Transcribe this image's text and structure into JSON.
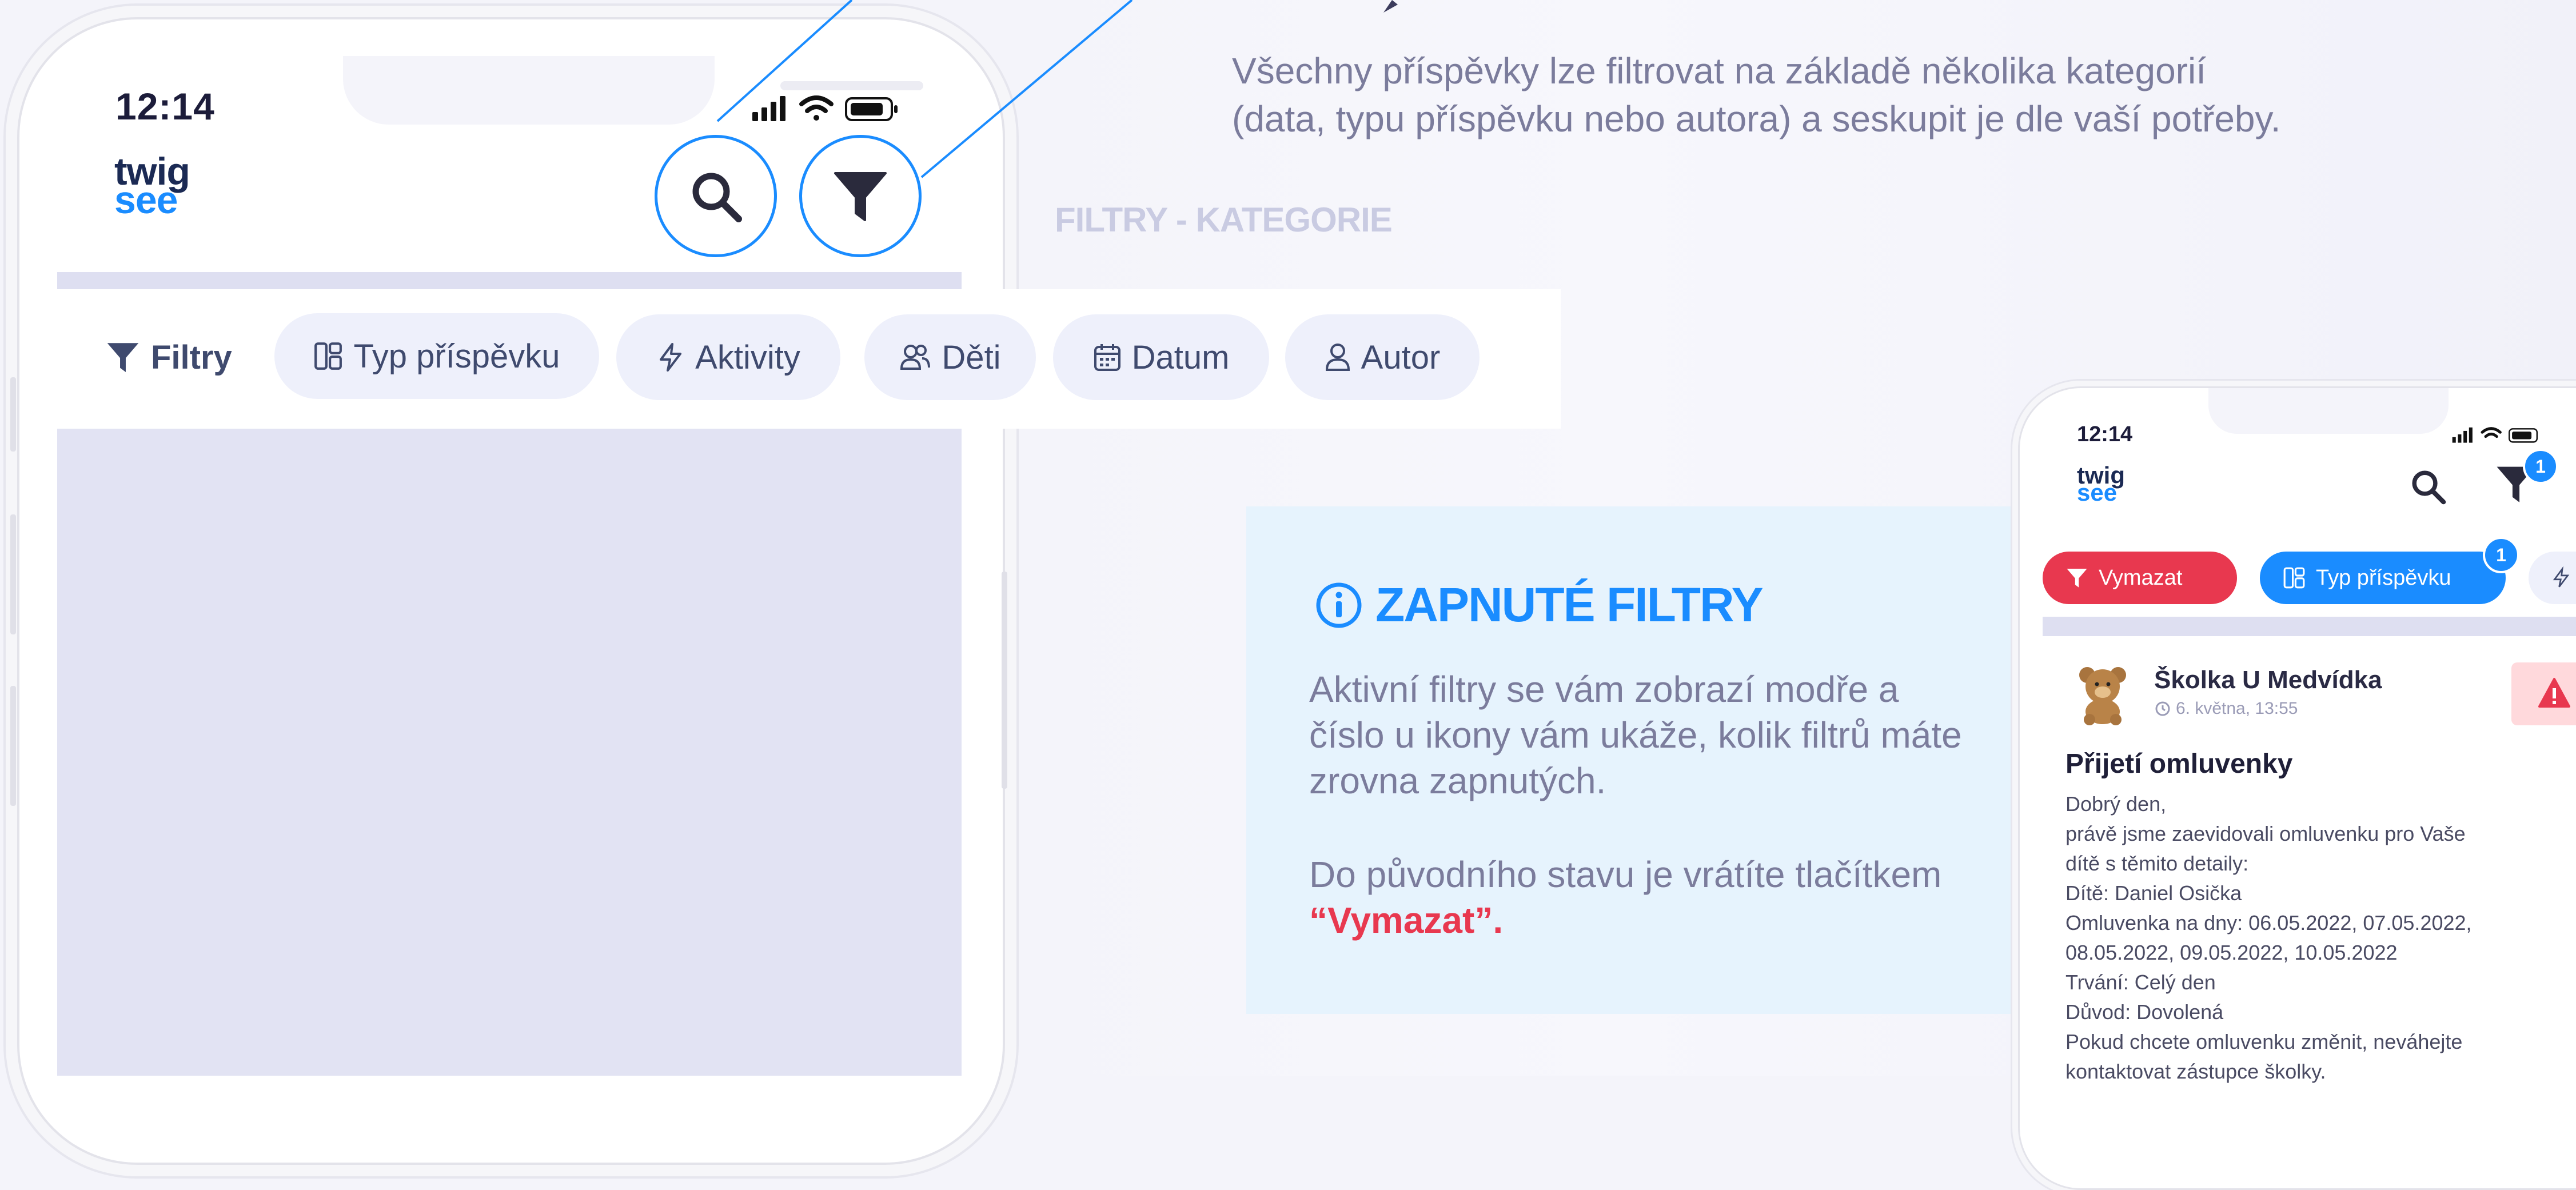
{
  "big_phone": {
    "time": "12:14",
    "logo": {
      "line1": "twig",
      "line2": "see"
    }
  },
  "filter_bar": {
    "label": "Filtry",
    "chips": [
      {
        "label": "Typ příspěvku",
        "icon": "layout-icon"
      },
      {
        "label": "Aktivity",
        "icon": "bolt-icon"
      },
      {
        "label": "Děti",
        "icon": "users-icon"
      },
      {
        "label": "Datum",
        "icon": "calendar-icon"
      },
      {
        "label": "Autor",
        "icon": "user-icon"
      }
    ]
  },
  "description": {
    "line1": "Všechny příspěvky lze filtrovat na základě několika kategorií",
    "line2": "(data, typu příspěvku nebo autora) a seskupit je dle vaší potřeby."
  },
  "section_label": "FILTRY - KATEGORIE",
  "info_box": {
    "title": "ZAPNUTÉ FILTRY",
    "paragraph1": "Aktivní filtry se vám zobrazí modře a číslo u ikony vám ukáže, kolik filtrů máte zrovna zapnutých.",
    "paragraph2_prefix": "Do původního stavu je vrátíte tlačítkem ",
    "paragraph2_highlight": "“Vymazat”."
  },
  "small_phone": {
    "time": "12:14",
    "logo": {
      "line1": "twig",
      "line2": "see"
    },
    "filter_badge": "1",
    "chips": {
      "clear": "Vymazat",
      "type": "Typ příspěvku",
      "type_badge": "1"
    },
    "post": {
      "sender": "Školka U Medvídka",
      "date": "6. května, 13:55",
      "title": "Přijetí omluvenky",
      "body": [
        "Dobrý den,",
        "právě jsme zaevidovali omluvenku pro Vaše",
        "dítě s těmito detaily:",
        "Dítě: Daniel Osička",
        "Omluvenka na dny: 06.05.2022, 07.05.2022,",
        "08.05.2022, 09.05.2022, 10.05.2022",
        "Trvání: Celý den",
        "Důvod: Dovolená",
        "Pokud chcete omluvenku změnit, neváhejte",
        "kontaktovat zástupce školky."
      ]
    }
  },
  "colors": {
    "accent_blue": "#1a8cff",
    "danger_red": "#e8384f",
    "muted_text": "#7b7c9c",
    "info_bg": "#e6f3fd"
  }
}
